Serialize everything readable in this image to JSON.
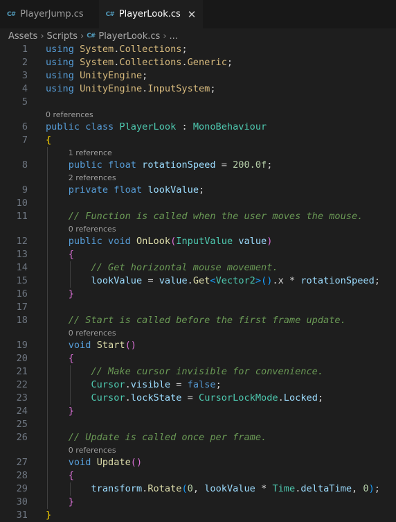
{
  "tabs": [
    {
      "label": "PlayerJump.cs",
      "icon": "csharp-file-icon",
      "active": false
    },
    {
      "label": "PlayerLook.cs",
      "icon": "csharp-file-icon",
      "active": true
    }
  ],
  "breadcrumb": [
    "Assets",
    "Scripts",
    "PlayerLook.cs",
    "..."
  ],
  "lenses": {
    "class": "0 references",
    "rotationSpeed": "1 reference",
    "lookValue": "2 references",
    "onLook": "0 references",
    "start": "0 references",
    "update": "0 references"
  },
  "lines": [
    {
      "n": "1",
      "text": "using System.Collections;"
    },
    {
      "n": "2",
      "text": "using System.Collections.Generic;"
    },
    {
      "n": "3",
      "text": "using UnityEngine;"
    },
    {
      "n": "4",
      "text": "using UnityEngine.InputSystem;"
    },
    {
      "n": "5",
      "text": ""
    },
    {
      "n": "6",
      "text": "public class PlayerLook : MonoBehaviour"
    },
    {
      "n": "7",
      "text": "{"
    },
    {
      "n": "8",
      "text": "    public float rotationSpeed = 200.0f;"
    },
    {
      "n": "9",
      "text": "    private float lookValue;"
    },
    {
      "n": "10",
      "text": ""
    },
    {
      "n": "11",
      "text": "    // Function is called when the user moves the mouse."
    },
    {
      "n": "12",
      "text": "    public void OnLook(InputValue value)"
    },
    {
      "n": "13",
      "text": "    {"
    },
    {
      "n": "14",
      "text": "        // Get horizontal mouse movement."
    },
    {
      "n": "15",
      "text": "        lookValue = value.Get<Vector2>().x * rotationSpeed;"
    },
    {
      "n": "16",
      "text": "    }"
    },
    {
      "n": "17",
      "text": ""
    },
    {
      "n": "18",
      "text": "    // Start is called before the first frame update."
    },
    {
      "n": "19",
      "text": "    void Start()"
    },
    {
      "n": "20",
      "text": "    {"
    },
    {
      "n": "21",
      "text": "        // Make cursor invisible for convenience."
    },
    {
      "n": "22",
      "text": "        Cursor.visible = false;"
    },
    {
      "n": "23",
      "text": "        Cursor.lockState = CursorLockMode.Locked;"
    },
    {
      "n": "24",
      "text": "    }"
    },
    {
      "n": "25",
      "text": ""
    },
    {
      "n": "26",
      "text": "    // Update is called once per frame."
    },
    {
      "n": "27",
      "text": "    void Update()"
    },
    {
      "n": "28",
      "text": "    {"
    },
    {
      "n": "29",
      "text": "        transform.Rotate(0, lookValue * Time.deltaTime, 0);"
    },
    {
      "n": "30",
      "text": "    }"
    },
    {
      "n": "31",
      "text": "}"
    }
  ]
}
